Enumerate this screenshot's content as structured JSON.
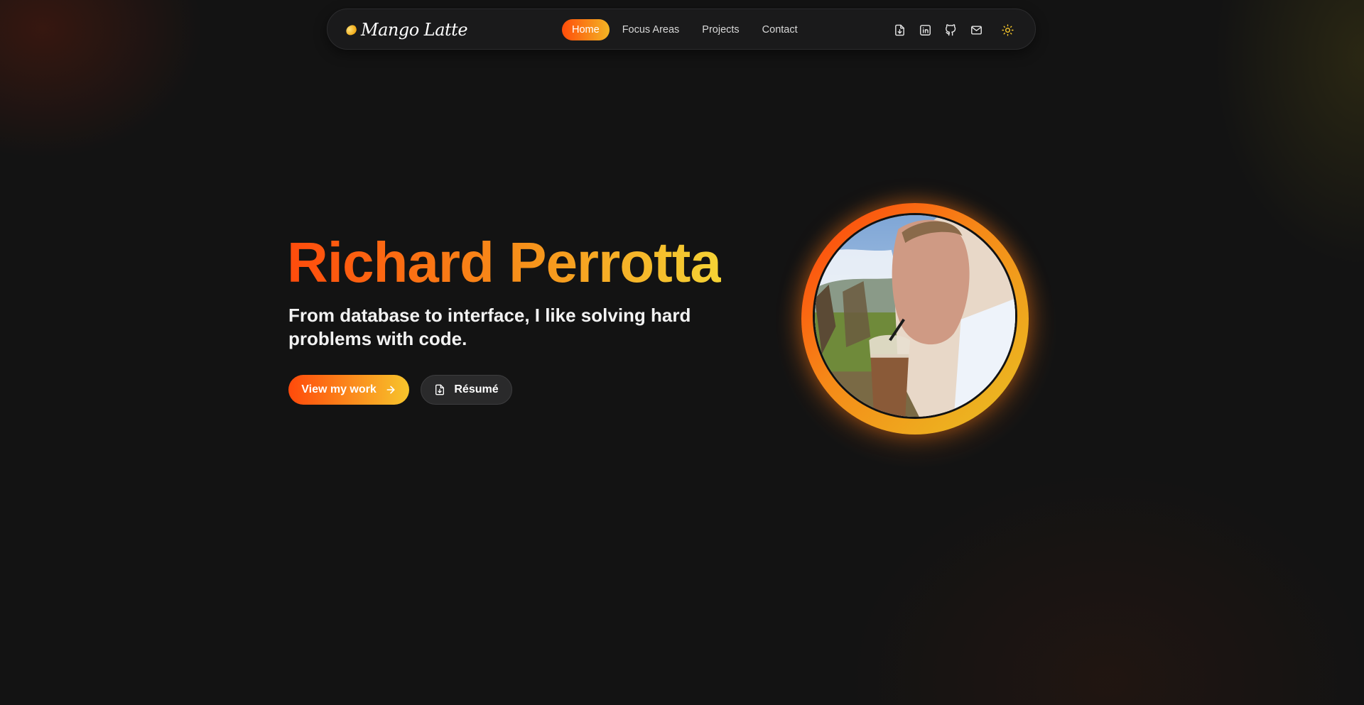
{
  "nav": {
    "logo_text": "Mango Latte",
    "links": [
      {
        "label": "Home",
        "active": true
      },
      {
        "label": "Focus Areas",
        "active": false
      },
      {
        "label": "Projects",
        "active": false
      },
      {
        "label": "Contact",
        "active": false
      }
    ],
    "icons": [
      "file-download-icon",
      "linkedin-icon",
      "github-icon",
      "mail-icon",
      "sun-icon"
    ]
  },
  "hero": {
    "name": "Richard Perrotta",
    "tagline": "From database to interface, I like solving hard problems with code.",
    "primary_cta": "View my work",
    "secondary_cta": "Résumé"
  },
  "colors": {
    "accent_start": "#ff4a0b",
    "accent_end": "#f7c52c",
    "background": "#131313",
    "nav_background": "#1a1a1b"
  }
}
